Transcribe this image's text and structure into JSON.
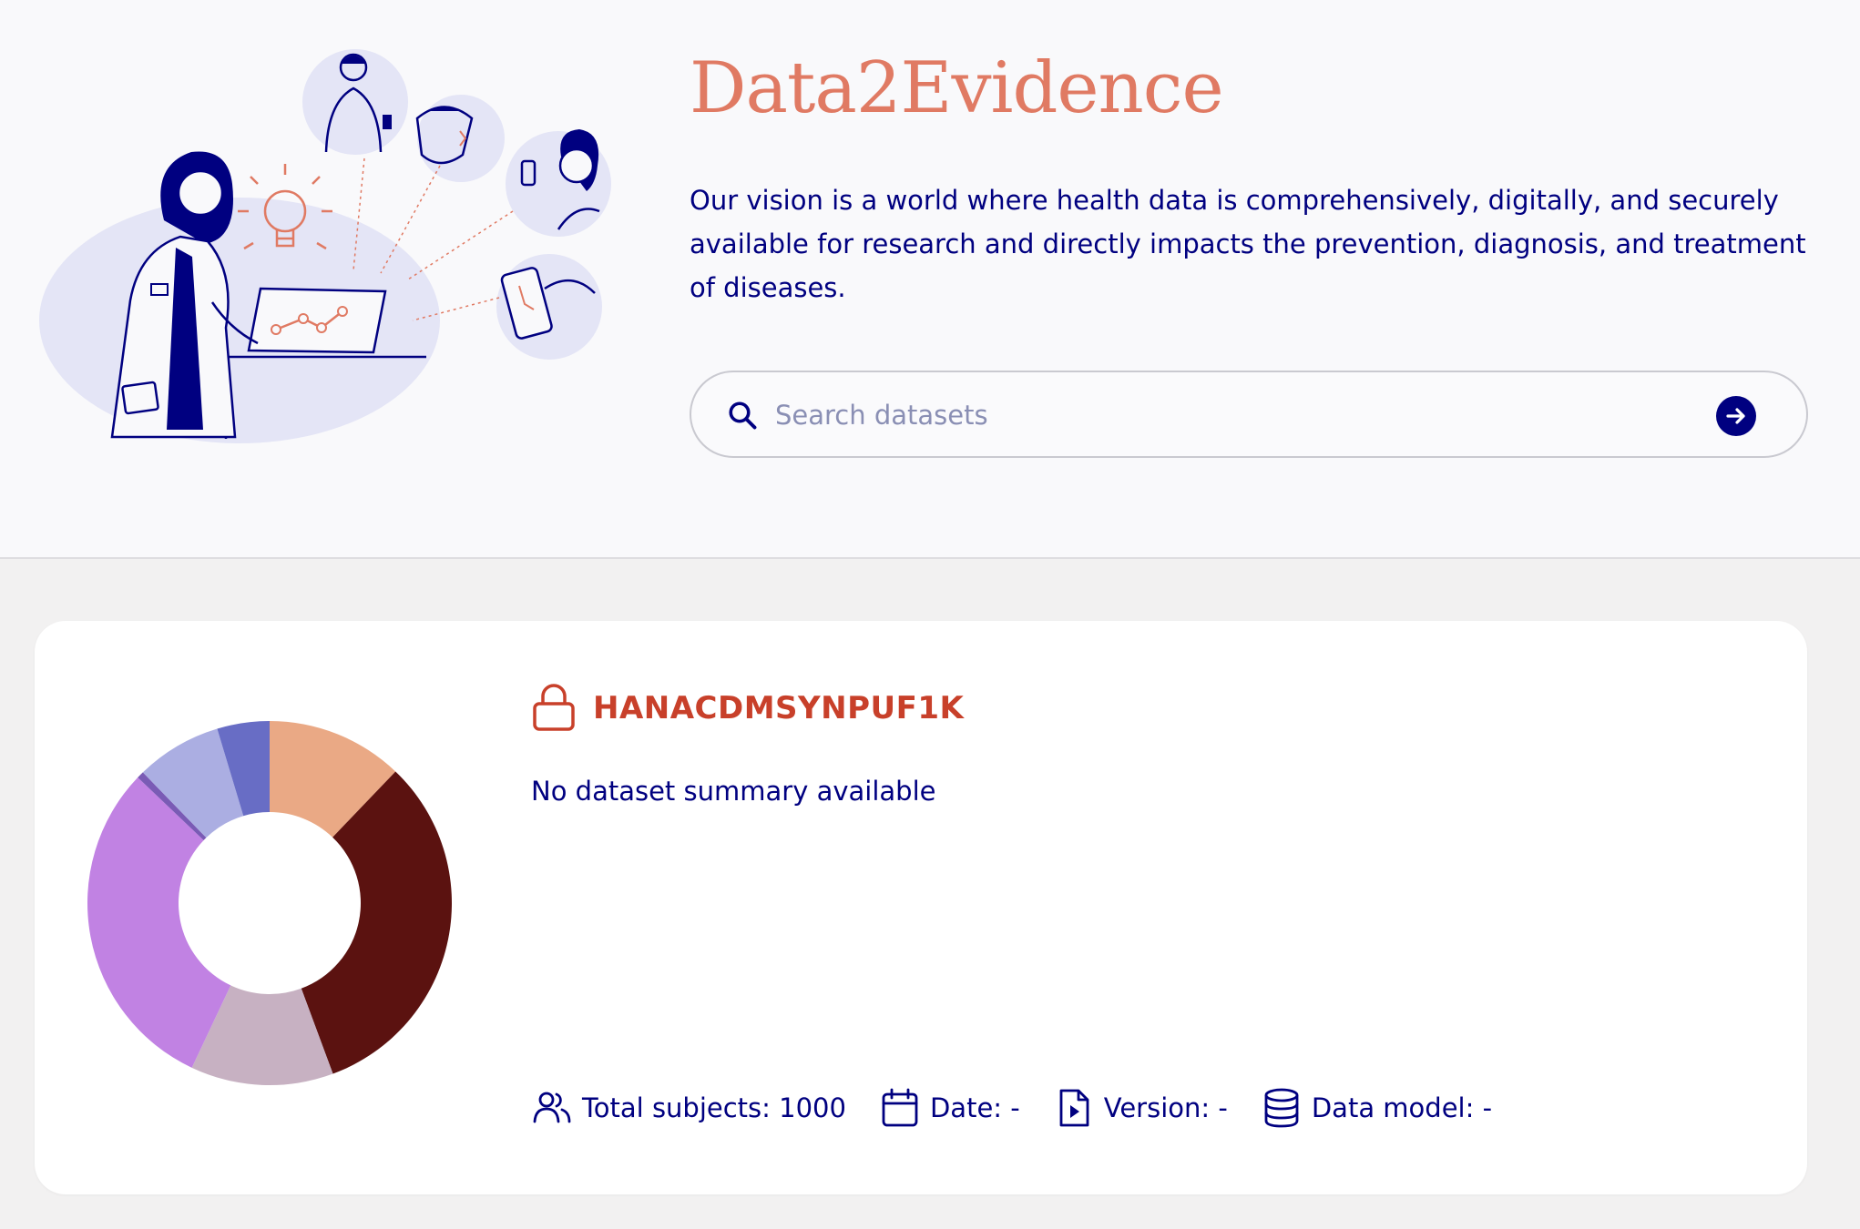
{
  "hero": {
    "title": "Data2Evidence",
    "vision": "Our vision is a world where health data is comprehensively, digitally, and securely available for research and directly impacts the prevention, diagnosis, and treatment of diseases.",
    "search": {
      "placeholder": "Search datasets",
      "value": ""
    }
  },
  "dataset": {
    "name": "HANACDMSYNPUF1K",
    "summary": "No dataset summary available",
    "meta": {
      "total_subjects": "Total subjects: 1000",
      "date": "Date: -",
      "version": "Version: -",
      "data_model": "Data model: -"
    }
  },
  "chart_data": {
    "type": "pie",
    "slices": [
      {
        "value": 11.5,
        "color": "#eaa985"
      },
      {
        "value": 30.5,
        "color": "#5b1210"
      },
      {
        "value": 12.0,
        "color": "#c7b1c2"
      },
      {
        "value": 28.5,
        "color": "#c182e3"
      },
      {
        "value": 0.6,
        "color": "#7a5bb5"
      },
      {
        "value": 7.2,
        "color": "#abaee2"
      },
      {
        "value": 4.4,
        "color": "#686dc5"
      }
    ]
  },
  "colors": {
    "brand": "#e07a63",
    "navy": "#000080",
    "dataset_name": "#c8402a"
  },
  "icons": {
    "search": "search-icon",
    "submit": "arrow-right-icon",
    "lock": "lock-icon",
    "subjects": "users-icon",
    "date": "calendar-icon",
    "version": "file-play-icon",
    "data_model": "database-icon"
  }
}
